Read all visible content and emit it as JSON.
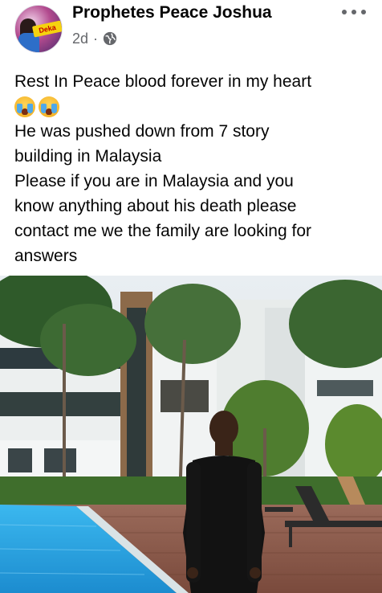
{
  "post": {
    "author": "Prophetes Peace Joshua",
    "time": "2d",
    "separator": "·",
    "privacy_icon": "globe-icon",
    "more_icon": "more-options-icon",
    "text_lines": [
      "Rest In Peace blood forever in my heart",
      "He was pushed down from 7 story",
      "building in Malaysia",
      "Please if you are in Malaysia and you",
      "know anything about his death please",
      "contact me we the family are looking for",
      "answers"
    ],
    "emojis": [
      "loudly-crying-face-emoji",
      "loudly-crying-face-emoji"
    ],
    "avatar_badge": "Deka"
  },
  "colors": {
    "text": "#050505",
    "secondary": "#65676b",
    "pool": "#27a9e6",
    "deck": "#8a5a4a"
  }
}
